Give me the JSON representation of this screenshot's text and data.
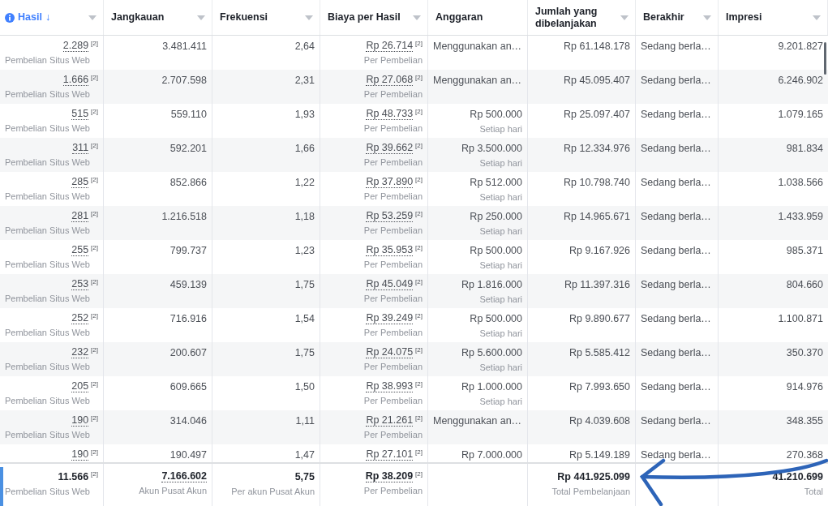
{
  "columns": [
    {
      "label": "Hasil",
      "sorted": true,
      "sort_arrow": "↓",
      "dropdown": true
    },
    {
      "label": "Jangkauan",
      "sorted": false,
      "dropdown": true
    },
    {
      "label": "Frekuensi",
      "sorted": false,
      "dropdown": true
    },
    {
      "label": "Biaya per Hasil",
      "sorted": false,
      "dropdown": true
    },
    {
      "label": "Anggaran",
      "sorted": false,
      "dropdown": false
    },
    {
      "label": "Jumlah yang dibelanjakan",
      "sorted": false,
      "dropdown": true
    },
    {
      "label": "Berakhir",
      "sorted": false,
      "dropdown": true
    },
    {
      "label": "Impresi",
      "sorted": false,
      "dropdown": true
    }
  ],
  "rows": [
    {
      "hasil": "2.289",
      "hasil_note": "[2]",
      "hasil_sub": "Pembelian Situs Web",
      "jangkauan": "3.481.411",
      "frekuensi": "2,64",
      "biaya": "Rp 26.714",
      "biaya_note": "[2]",
      "biaya_sub": "Per Pembelian",
      "anggaran": {
        "kind": "text",
        "value": "Menggunakan an…"
      },
      "jumlah": "Rp 61.148.178",
      "berakhir": "Sedang berla…",
      "impresi": "9.201.827"
    },
    {
      "hasil": "1.666",
      "hasil_note": "[2]",
      "hasil_sub": "Pembelian Situs Web",
      "jangkauan": "2.707.598",
      "frekuensi": "2,31",
      "biaya": "Rp 27.068",
      "biaya_note": "[2]",
      "biaya_sub": "Per Pembelian",
      "anggaran": {
        "kind": "text",
        "value": "Menggunakan an…"
      },
      "jumlah": "Rp 45.095.407",
      "berakhir": "Sedang berla…",
      "impresi": "6.246.902"
    },
    {
      "hasil": "515",
      "hasil_note": "[2]",
      "hasil_sub": "Pembelian Situs Web",
      "jangkauan": "559.110",
      "frekuensi": "1,93",
      "biaya": "Rp 48.733",
      "biaya_note": "[2]",
      "biaya_sub": "Per Pembelian",
      "anggaran": {
        "kind": "amount",
        "value": "Rp 500.000",
        "sub": "Setiap hari"
      },
      "jumlah": "Rp 25.097.407",
      "berakhir": "Sedang berla…",
      "impresi": "1.079.165"
    },
    {
      "hasil": "311",
      "hasil_note": "[2]",
      "hasil_sub": "Pembelian Situs Web",
      "jangkauan": "592.201",
      "frekuensi": "1,66",
      "biaya": "Rp 39.662",
      "biaya_note": "[2]",
      "biaya_sub": "Per Pembelian",
      "anggaran": {
        "kind": "amount",
        "value": "Rp 3.500.000",
        "sub": "Setiap hari"
      },
      "jumlah": "Rp 12.334.976",
      "berakhir": "Sedang berla…",
      "impresi": "981.834"
    },
    {
      "hasil": "285",
      "hasil_note": "[2]",
      "hasil_sub": "Pembelian Situs Web",
      "jangkauan": "852.866",
      "frekuensi": "1,22",
      "biaya": "Rp 37.890",
      "biaya_note": "[2]",
      "biaya_sub": "Per Pembelian",
      "anggaran": {
        "kind": "amount",
        "value": "Rp 512.000",
        "sub": "Setiap hari"
      },
      "jumlah": "Rp 10.798.740",
      "berakhir": "Sedang berla…",
      "impresi": "1.038.566"
    },
    {
      "hasil": "281",
      "hasil_note": "[2]",
      "hasil_sub": "Pembelian Situs Web",
      "jangkauan": "1.216.518",
      "frekuensi": "1,18",
      "biaya": "Rp 53.259",
      "biaya_note": "[2]",
      "biaya_sub": "Per Pembelian",
      "anggaran": {
        "kind": "amount",
        "value": "Rp 250.000",
        "sub": "Setiap hari"
      },
      "jumlah": "Rp 14.965.671",
      "berakhir": "Sedang berla…",
      "impresi": "1.433.959"
    },
    {
      "hasil": "255",
      "hasil_note": "[2]",
      "hasil_sub": "Pembelian Situs Web",
      "jangkauan": "799.737",
      "frekuensi": "1,23",
      "biaya": "Rp 35.953",
      "biaya_note": "[2]",
      "biaya_sub": "Per Pembelian",
      "anggaran": {
        "kind": "amount",
        "value": "Rp 500.000",
        "sub": "Setiap hari"
      },
      "jumlah": "Rp 9.167.926",
      "berakhir": "Sedang berla…",
      "impresi": "985.371"
    },
    {
      "hasil": "253",
      "hasil_note": "[2]",
      "hasil_sub": "Pembelian Situs Web",
      "jangkauan": "459.139",
      "frekuensi": "1,75",
      "biaya": "Rp 45.049",
      "biaya_note": "[2]",
      "biaya_sub": "Per Pembelian",
      "anggaran": {
        "kind": "amount",
        "value": "Rp 1.816.000",
        "sub": "Setiap hari"
      },
      "jumlah": "Rp 11.397.316",
      "berakhir": "Sedang berla…",
      "impresi": "804.660"
    },
    {
      "hasil": "252",
      "hasil_note": "[2]",
      "hasil_sub": "Pembelian Situs Web",
      "jangkauan": "716.916",
      "frekuensi": "1,54",
      "biaya": "Rp 39.249",
      "biaya_note": "[2]",
      "biaya_sub": "Per Pembelian",
      "anggaran": {
        "kind": "amount",
        "value": "Rp 500.000",
        "sub": "Setiap hari"
      },
      "jumlah": "Rp 9.890.677",
      "berakhir": "Sedang berla…",
      "impresi": "1.100.871"
    },
    {
      "hasil": "232",
      "hasil_note": "[2]",
      "hasil_sub": "Pembelian Situs Web",
      "jangkauan": "200.607",
      "frekuensi": "1,75",
      "biaya": "Rp 24.075",
      "biaya_note": "[2]",
      "biaya_sub": "Per Pembelian",
      "anggaran": {
        "kind": "amount",
        "value": "Rp 5.600.000",
        "sub": "Setiap hari"
      },
      "jumlah": "Rp 5.585.412",
      "berakhir": "Sedang berla…",
      "impresi": "350.370"
    },
    {
      "hasil": "205",
      "hasil_note": "[2]",
      "hasil_sub": "Pembelian Situs Web",
      "jangkauan": "609.665",
      "frekuensi": "1,50",
      "biaya": "Rp 38.993",
      "biaya_note": "[2]",
      "biaya_sub": "Per Pembelian",
      "anggaran": {
        "kind": "amount",
        "value": "Rp 1.000.000",
        "sub": "Setiap hari"
      },
      "jumlah": "Rp 7.993.650",
      "berakhir": "Sedang berla…",
      "impresi": "914.976"
    },
    {
      "hasil": "190",
      "hasil_note": "[2]",
      "hasil_sub": "Pembelian Situs Web",
      "jangkauan": "314.046",
      "frekuensi": "1,11",
      "biaya": "Rp 21.261",
      "biaya_note": "[2]",
      "biaya_sub": "Per Pembelian",
      "anggaran": {
        "kind": "text",
        "value": "Menggunakan an…"
      },
      "jumlah": "Rp 4.039.608",
      "berakhir": "Sedang berla…",
      "impresi": "348.355"
    },
    {
      "hasil": "190",
      "hasil_note": "[2]",
      "jangkauan": "190.497",
      "frekuensi": "1,47",
      "biaya": "Rp 27.101",
      "biaya_note": "[2]",
      "anggaran": {
        "kind": "amount",
        "value": "Rp 7.000.000"
      },
      "jumlah": "Rp 5.149.189",
      "berakhir": "Sedang berla…",
      "impresi": "270.368"
    }
  ],
  "totals": {
    "hasil": "11.566",
    "hasil_note": "[2]",
    "hasil_sub": "Pembelian Situs Web",
    "jangkauan": "7.166.602",
    "jangkauan_sub": "Akun Pusat Akun",
    "frekuensi": "5,75",
    "frekuensi_sub": "Per akun Pusat Akun",
    "biaya": "Rp 38.209",
    "biaya_note": "[2]",
    "biaya_sub": "Per Pembelian",
    "jumlah": "Rp 441.925.099",
    "jumlah_sub": "Total Pembelanjaan",
    "impresi": "41.210.699",
    "impresi_sub": "Total"
  }
}
